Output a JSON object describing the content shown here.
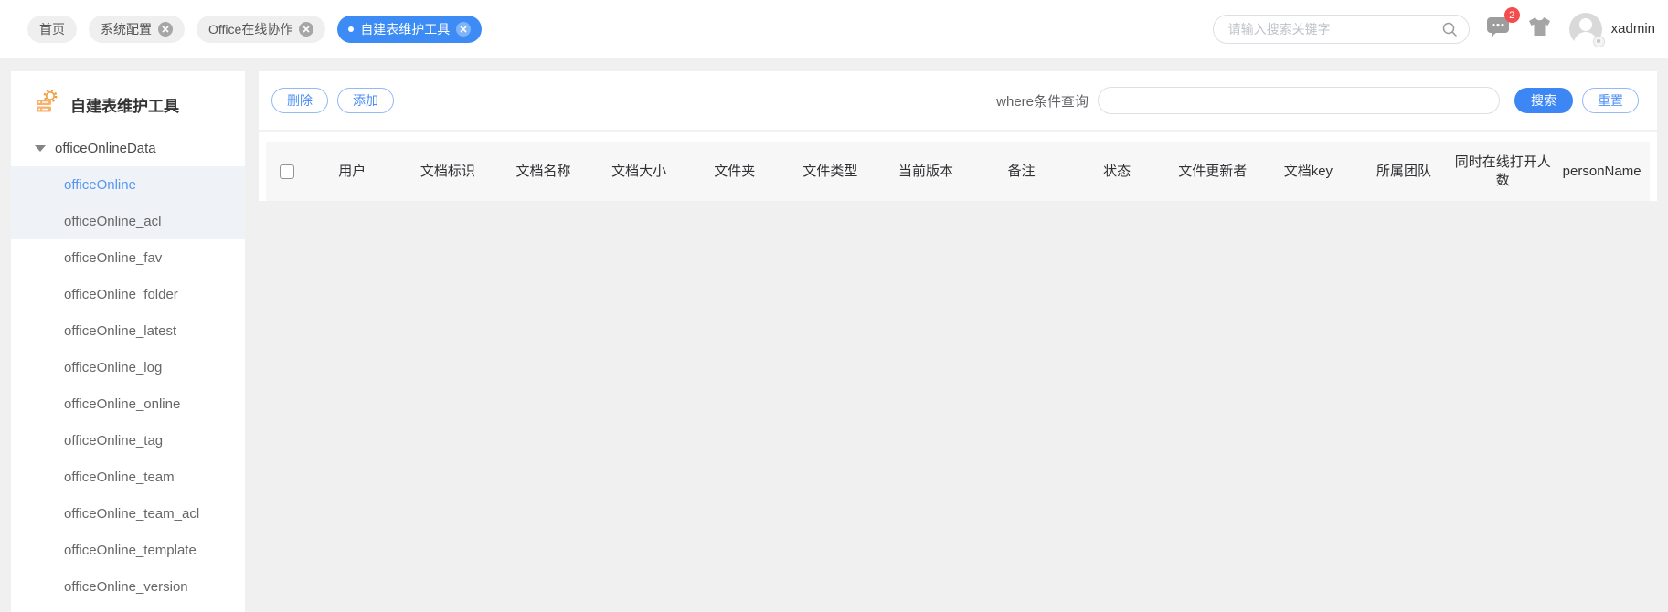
{
  "topbar": {
    "tabs": [
      {
        "label": "首页",
        "closable": false,
        "active": false
      },
      {
        "label": "系统配置",
        "closable": true,
        "active": false
      },
      {
        "label": "Office在线协作",
        "closable": true,
        "active": false
      },
      {
        "label": "自建表维护工具",
        "closable": true,
        "active": true
      }
    ],
    "search_placeholder": "请输入搜索关键字",
    "message_badge": "2",
    "username": "xadmin"
  },
  "sidebar": {
    "title": "自建表维护工具",
    "root": "officeOnlineData",
    "selected": "officeOnline",
    "items": [
      "officeOnline",
      "officeOnline_acl",
      "officeOnline_fav",
      "officeOnline_folder",
      "officeOnline_latest",
      "officeOnline_log",
      "officeOnline_online",
      "officeOnline_tag",
      "officeOnline_team",
      "officeOnline_team_acl",
      "officeOnline_template",
      "officeOnline_version"
    ]
  },
  "toolbar": {
    "delete_label": "删除",
    "add_label": "添加",
    "where_label": "where条件查询",
    "where_value": "",
    "search_label": "搜索",
    "reset_label": "重置"
  },
  "table": {
    "columns": [
      "用户",
      "文档标识",
      "文档名称",
      "文档大小",
      "文件夹",
      "文件类型",
      "当前版本",
      "备注",
      "状态",
      "文件更新者",
      "文档key",
      "所属团队",
      "同时在线打开人数",
      "personName"
    ],
    "rows": []
  },
  "colors": {
    "accent_blue": "#3d8cf5",
    "badge_red": "#f34d4d",
    "tree_highlight": "#eff3f8",
    "table_header_bg": "#f7f7f8",
    "sidebar_icon_orange": "#f2a54a"
  }
}
